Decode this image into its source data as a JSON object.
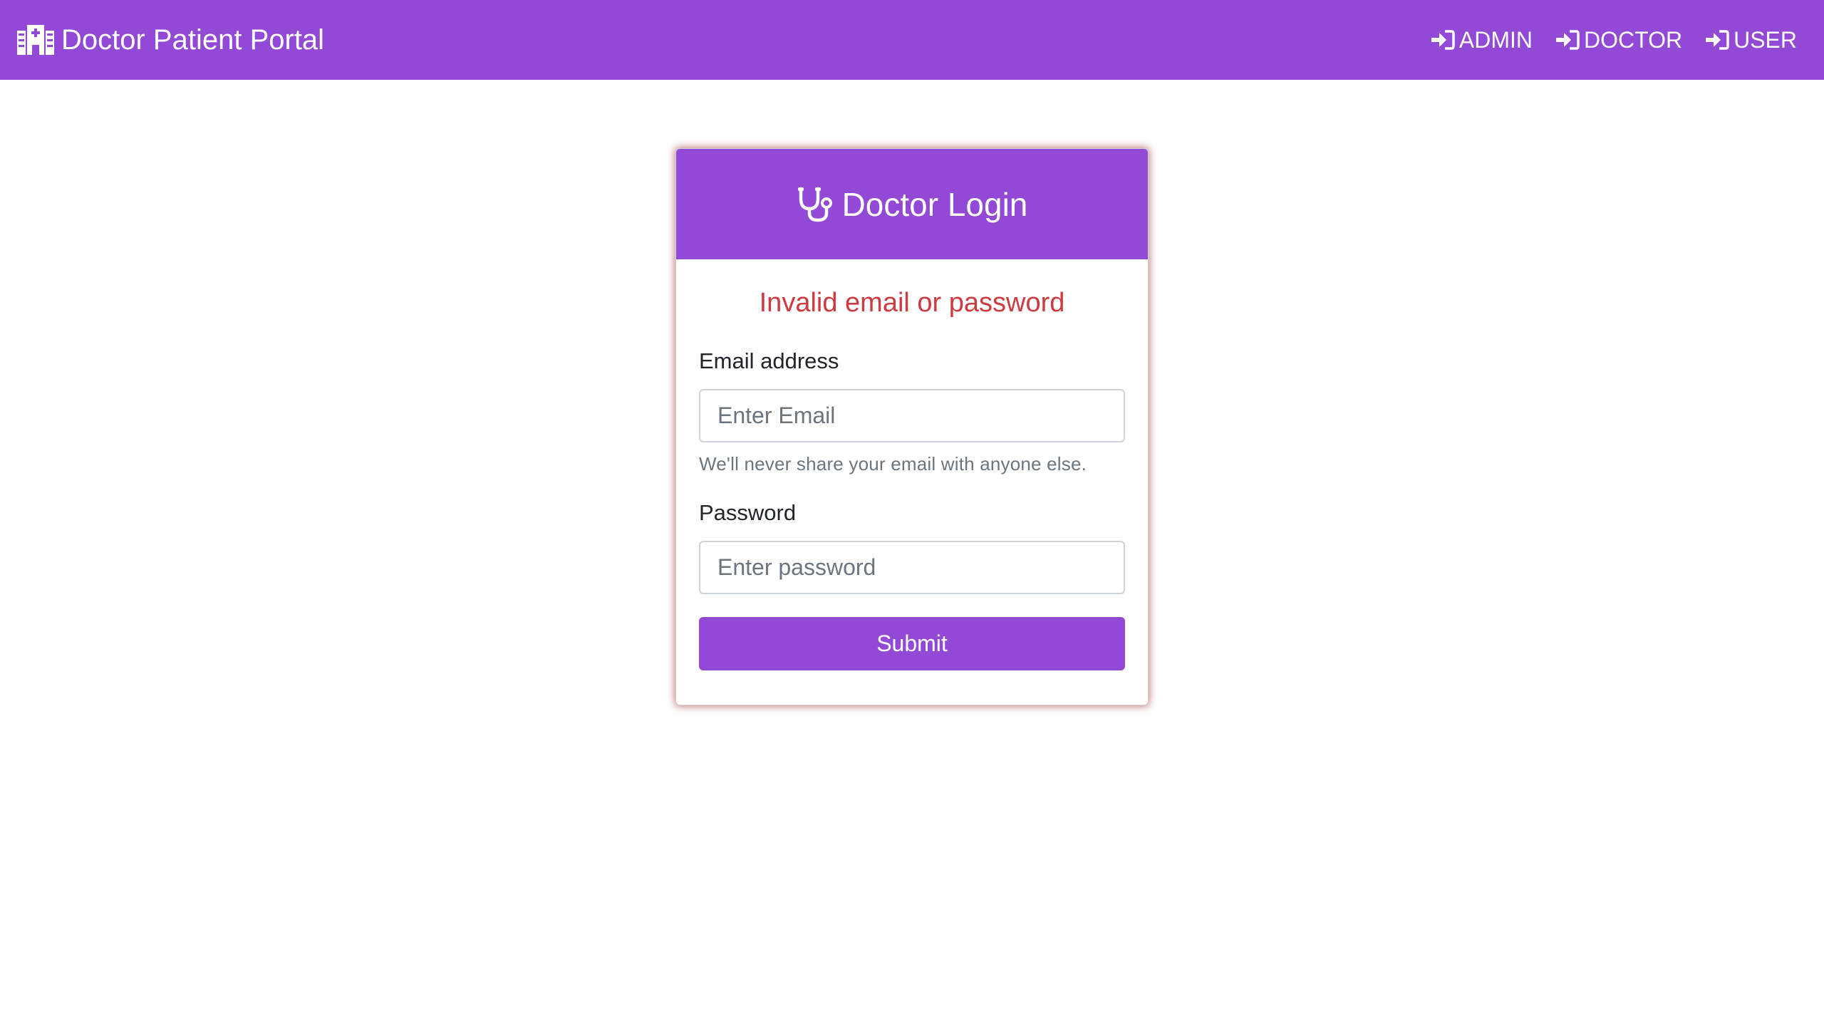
{
  "navbar": {
    "brand_icon": "hospital-icon",
    "brand": "Doctor Patient Portal",
    "links": [
      {
        "icon": "sign-in-icon",
        "label": "ADMIN"
      },
      {
        "icon": "sign-in-icon",
        "label": "DOCTOR"
      },
      {
        "icon": "sign-in-icon",
        "label": "USER"
      }
    ]
  },
  "login": {
    "icon": "stethoscope-icon",
    "title": "Doctor Login",
    "error": "Invalid email or password",
    "email_label": "Email address",
    "email_placeholder": "Enter Email",
    "email_help": "We'll never share your email with anyone else.",
    "password_label": "Password",
    "password_placeholder": "Enter password",
    "submit_label": "Submit"
  },
  "colors": {
    "accent": "#9249d6",
    "error": "#cd3a3f",
    "muted": "#6c757d"
  }
}
